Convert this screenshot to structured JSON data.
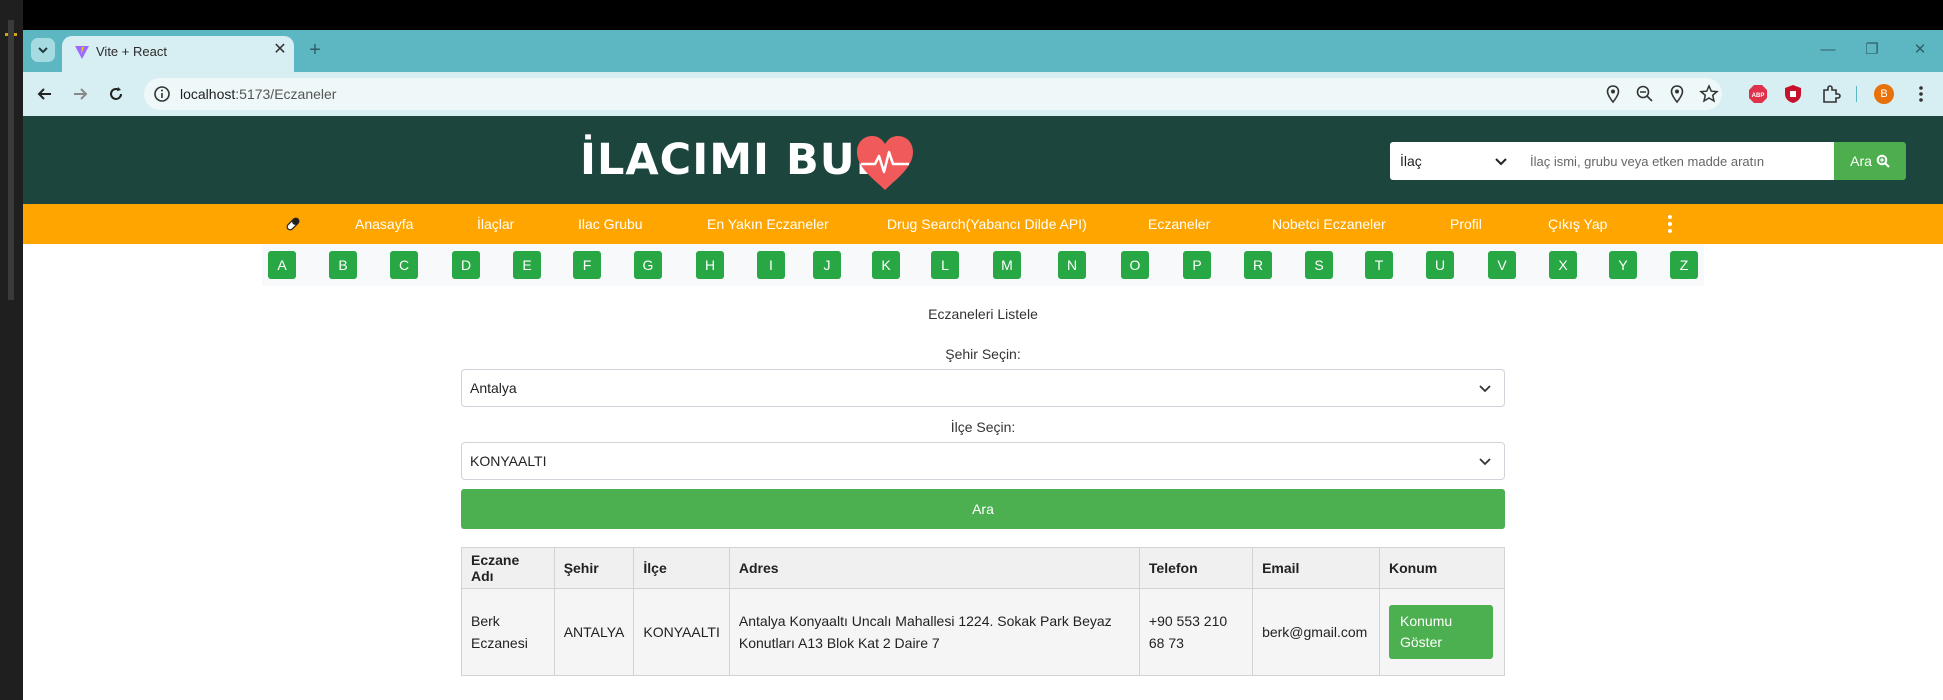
{
  "browser": {
    "tab_title": "Vite + React",
    "new_tab_glyph": "+",
    "close_glyph": "✕",
    "url_host": "localhost",
    "url_path": ":5173/Eczaneler",
    "profile_initial": "B",
    "window_controls": {
      "minimize": "—",
      "restore": "❐",
      "close": "✕"
    }
  },
  "header": {
    "brand_title": "İLACIMI BUL",
    "search_type_selected": "İlaç",
    "search_placeholder": "İlaç ismi, grubu veya etken madde aratın",
    "search_button_label": "Ara"
  },
  "nav": {
    "items": [
      "Anasayfa",
      "İlaçlar",
      "Ilac Grubu",
      "En Yakın Eczaneler",
      "Drug Search(Yabancı Dilde API)",
      "Eczaneler",
      "Nobetci Eczaneler",
      "Profil",
      "Çıkış Yap"
    ]
  },
  "letters": [
    "A",
    "B",
    "C",
    "D",
    "E",
    "F",
    "G",
    "H",
    "I",
    "J",
    "K",
    "L",
    "M",
    "N",
    "O",
    "P",
    "R",
    "S",
    "T",
    "U",
    "V",
    "X",
    "Y",
    "Z"
  ],
  "main": {
    "heading": "Eczaneleri Listele",
    "city_label": "Şehir Seçin:",
    "city_value": "Antalya",
    "district_label": "İlçe Seçin:",
    "district_value": "KONYAALTI",
    "search_button": "Ara"
  },
  "table": {
    "headers": [
      "Eczane Adı",
      "Şehir",
      "İlçe",
      "Adres",
      "Telefon",
      "Email",
      "Konum"
    ],
    "rows": [
      {
        "name": "Berk Eczanesi",
        "city": "ANTALYA",
        "district": "KONYAALTI",
        "address": "Antalya Konyaaltı Uncalı Mahallesi 1224. Sokak Park Beyaz Konutları A13 Blok Kat 2 Daire 7",
        "phone": "+90 553 210 68 73",
        "email": "berk@gmail.com",
        "location_button": "Konumu Göster"
      }
    ]
  },
  "colors": {
    "header_bg": "#1b453d",
    "nav_bg": "#ffa500",
    "accent_green": "#4caf50",
    "letter_green": "#28a745",
    "logo_heart": "#f05a5a"
  }
}
